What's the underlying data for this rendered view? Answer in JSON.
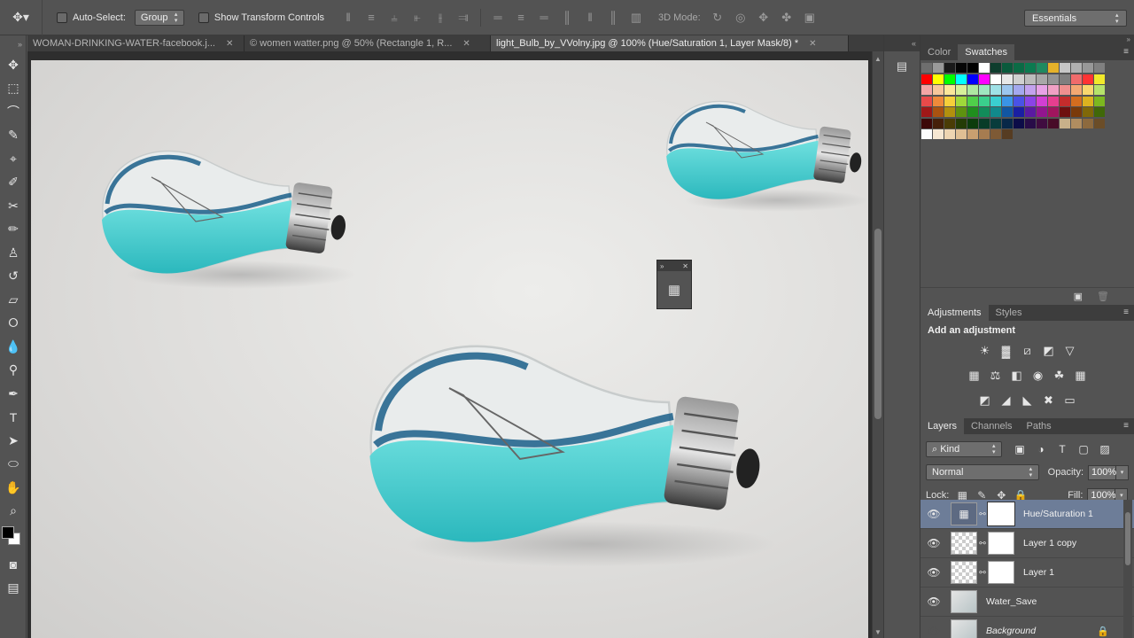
{
  "options_bar": {
    "auto_select_label": "Auto-Select:",
    "auto_select_mode": "Group",
    "show_transform_label": "Show Transform Controls",
    "mode_3d_label": "3D Mode:",
    "workspace": "Essentials"
  },
  "tabs": [
    {
      "title": "WOMAN-DRINKING-WATER-facebook.j...",
      "active": false
    },
    {
      "title": "© women watter.png @ 50% (Rectangle 1, R...",
      "active": false
    },
    {
      "title": "light_Bulb_by_VVolny.jpg @ 100% (Hue/Saturation 1, Layer Mask/8) *",
      "active": true
    }
  ],
  "color_panel": {
    "tabs": [
      "Color",
      "Swatches"
    ],
    "active_tab": "Swatches"
  },
  "adjustments_panel": {
    "tabs": [
      "Adjustments",
      "Styles"
    ],
    "title": "Add an adjustment"
  },
  "layers_panel": {
    "tabs": [
      "Layers",
      "Channels",
      "Paths"
    ],
    "kind_filter": "Kind",
    "blend_mode": "Normal",
    "opacity_label": "Opacity:",
    "opacity": "100%",
    "lock_label": "Lock:",
    "fill_label": "Fill:",
    "fill": "100%",
    "layers": [
      {
        "name": "Hue/Saturation 1",
        "type": "adjustment",
        "selected": true,
        "visible": true
      },
      {
        "name": "Layer 1 copy",
        "type": "masked",
        "selected": false,
        "visible": true
      },
      {
        "name": "Layer 1",
        "type": "masked",
        "selected": false,
        "visible": true
      },
      {
        "name": "Water_Save",
        "type": "image",
        "selected": false,
        "visible": true
      },
      {
        "name": "Background",
        "type": "background",
        "selected": false,
        "visible": false,
        "locked": true
      }
    ]
  },
  "colors": {
    "ui_bg": "#535353",
    "panel_header": "#3d3d3d",
    "selected_layer": "#6d7d98",
    "water_cyan": "#4fd0d0"
  }
}
